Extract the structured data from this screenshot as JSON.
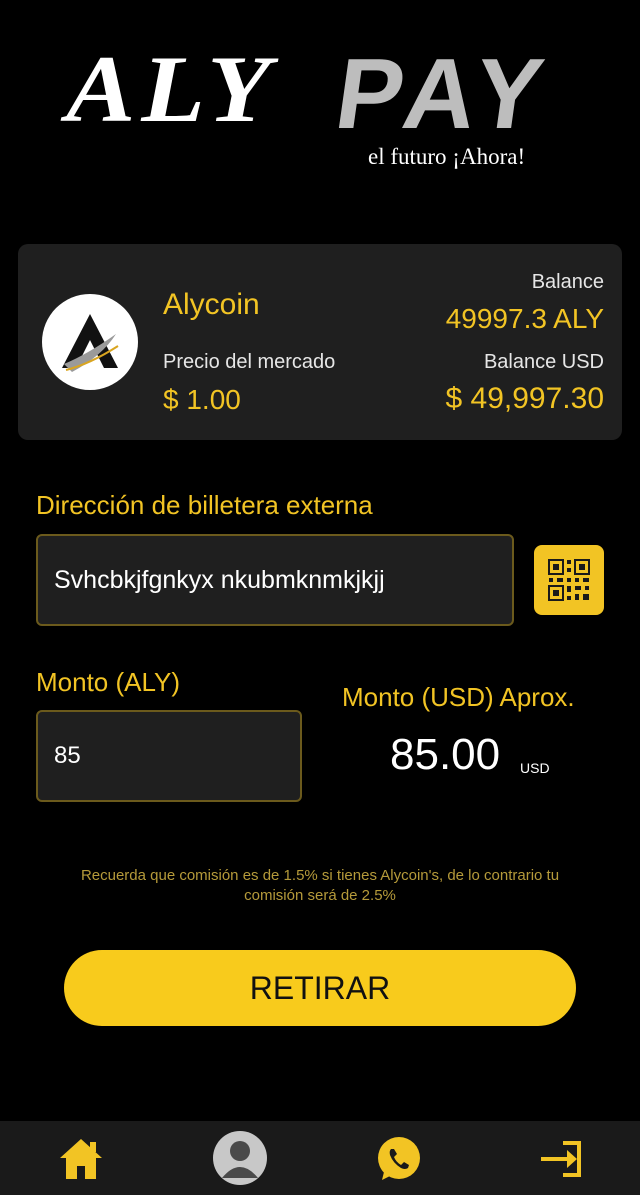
{
  "logo": {
    "word_left": "ALY",
    "word_right": "PAY",
    "tagline": "el futuro ¡Ahora!"
  },
  "coin": {
    "name": "Alycoin",
    "price_label": "Precio del mercado",
    "price_value": "$ 1.00",
    "balance_label": "Balance",
    "balance_value": "49997.3 ALY",
    "balance_usd_label": "Balance USD",
    "balance_usd_value": "$ 49,997.30"
  },
  "address": {
    "label": "Dirección de billetera externa",
    "value": "Svhcbkjfgnkyx nkubmknmkjkjj"
  },
  "amount": {
    "label": "Monto (ALY)",
    "value": "85",
    "usd_label": "Monto (USD) Aprox.",
    "usd_value": "85.00",
    "usd_unit": "USD"
  },
  "notice": "Recuerda que comisión es de 1.5% si tienes Alycoin's, de lo contrario tu comisión será de 2.5%",
  "withdraw_label": "RETIRAR",
  "nav": {
    "items": [
      {
        "icon": "home-icon"
      },
      {
        "icon": "profile-avatar"
      },
      {
        "icon": "whatsapp-icon"
      },
      {
        "icon": "logout-icon"
      }
    ]
  },
  "colors": {
    "background": "#000000",
    "accent": "#f2c424",
    "card": "#1f1f1f",
    "button": "#f8cb1c"
  }
}
